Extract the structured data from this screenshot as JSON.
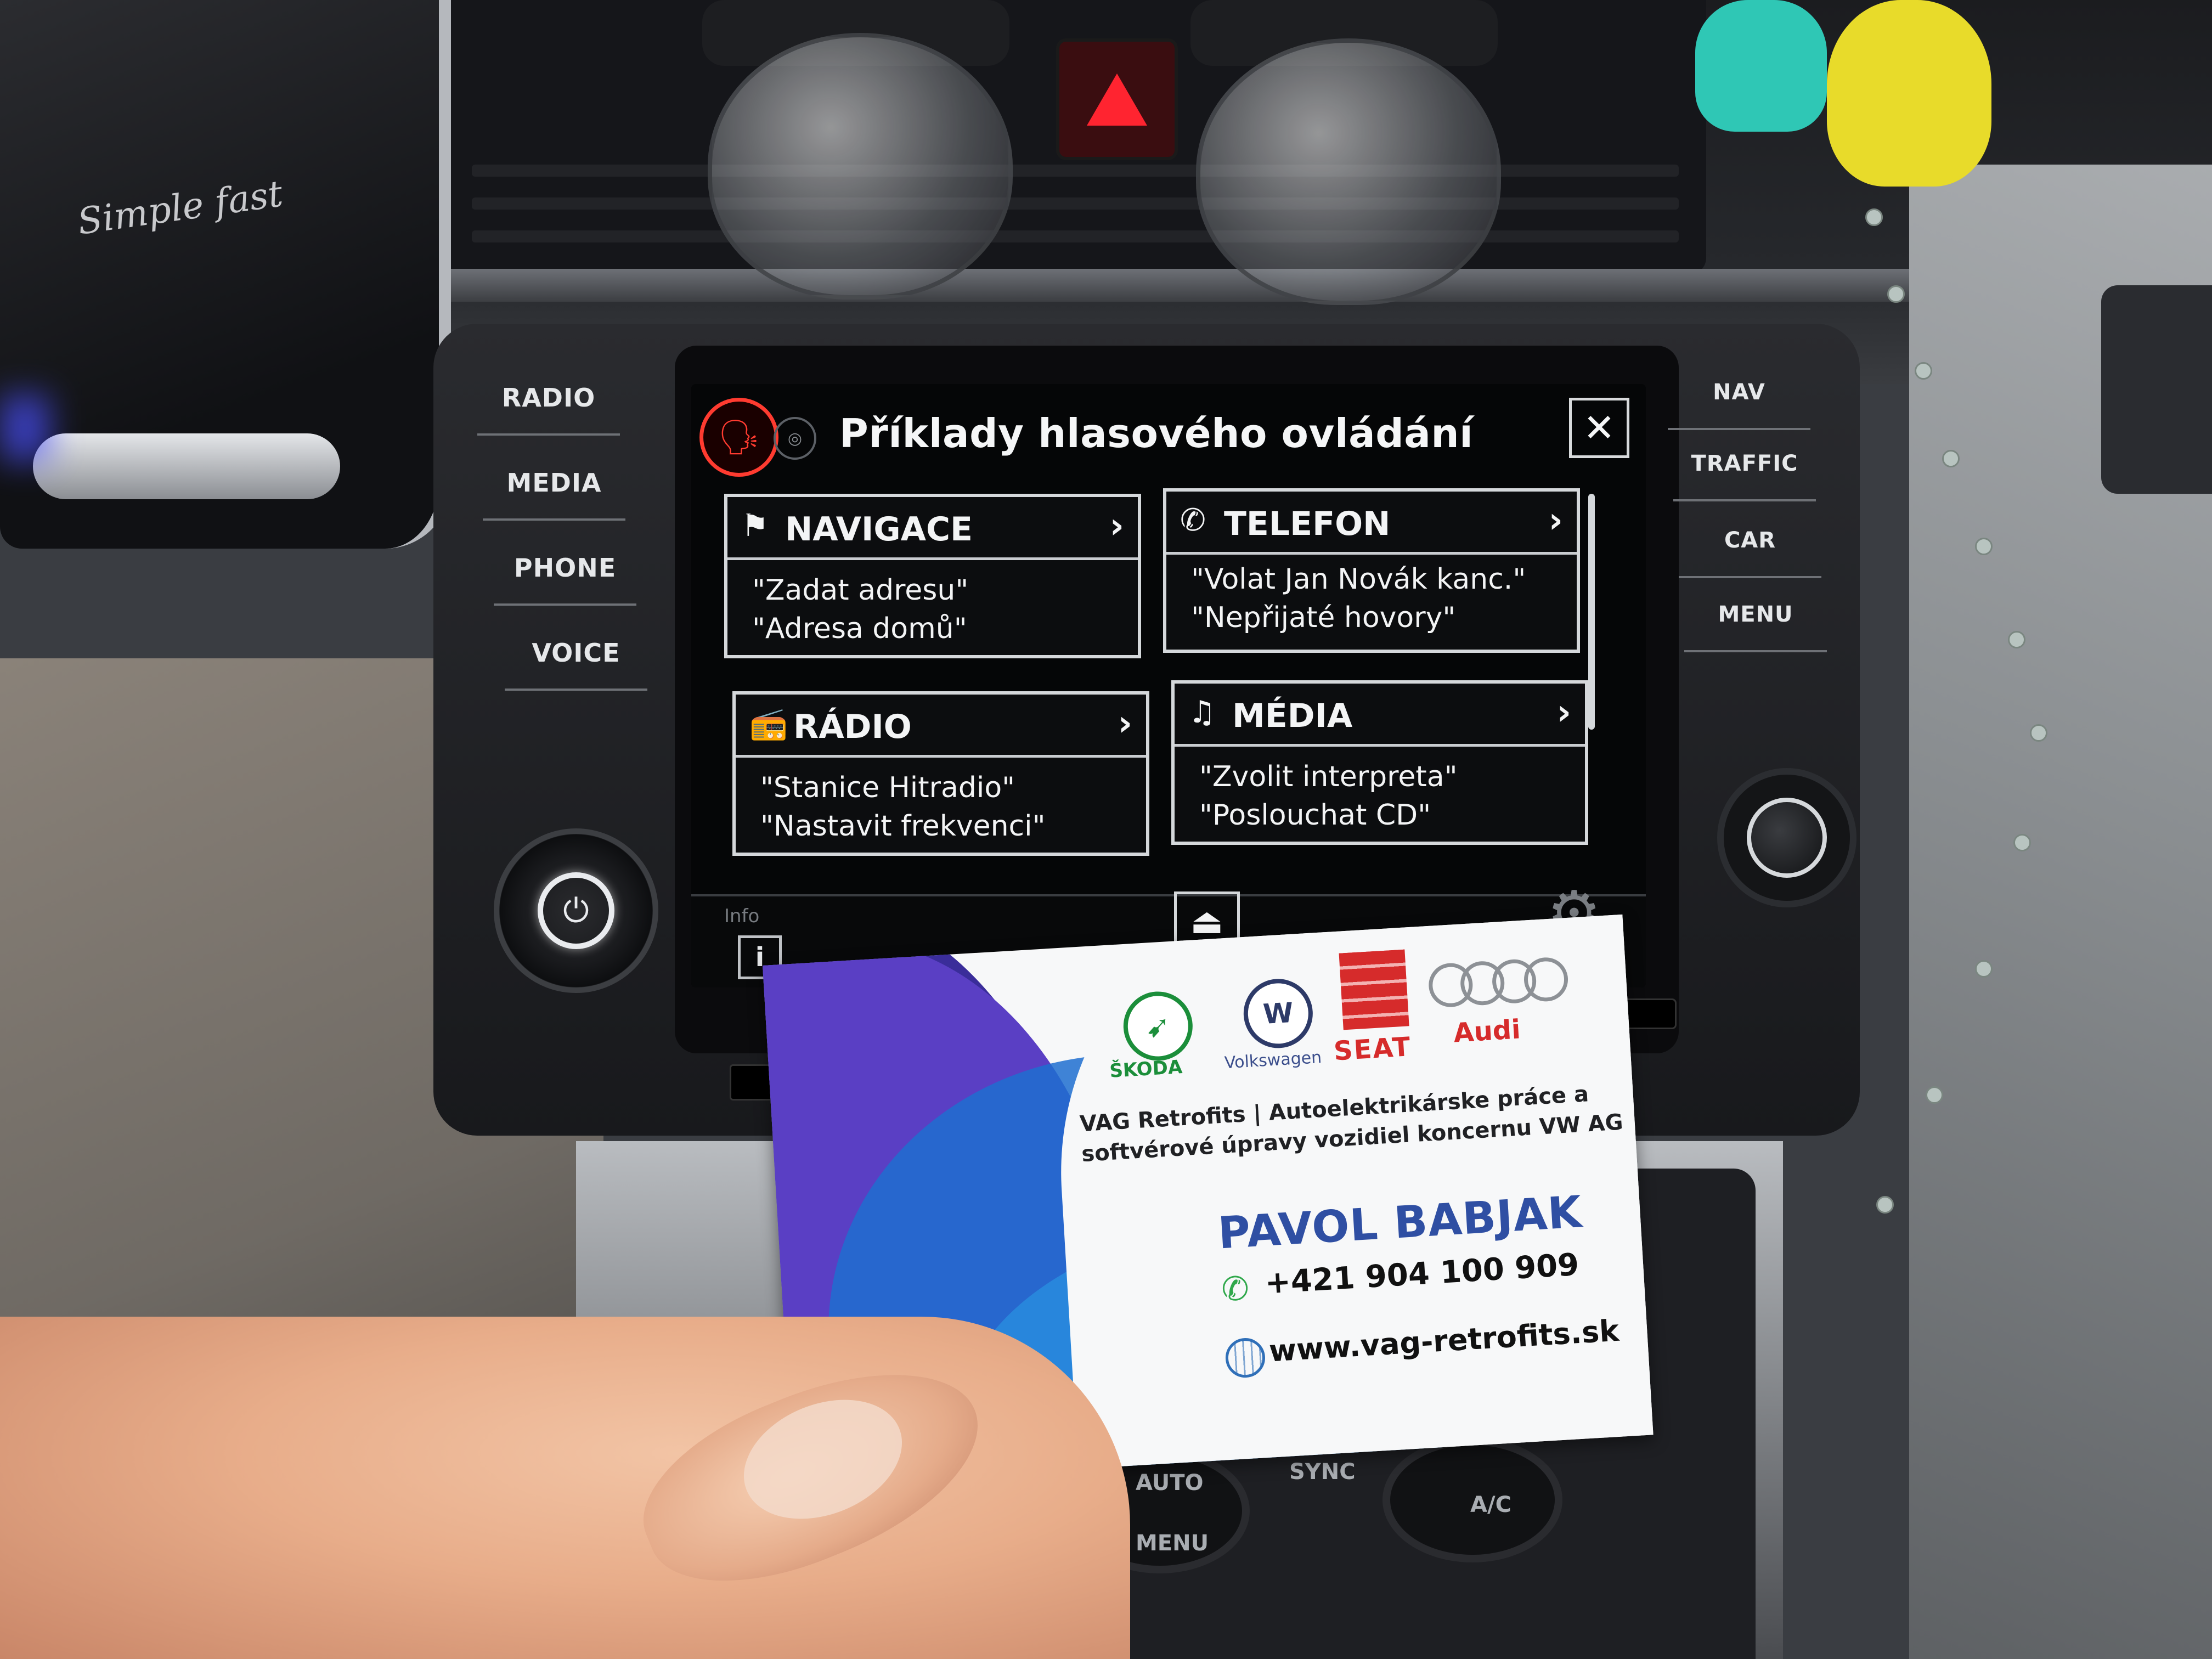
{
  "phone_holder": {
    "brand": "Simple fast"
  },
  "head_unit": {
    "left_buttons": [
      "RADIO",
      "MEDIA",
      "PHONE",
      "VOICE"
    ],
    "right_buttons": [
      "NAV",
      "TRAFFIC",
      "CAR",
      "MENU"
    ]
  },
  "screen": {
    "title": "Příklady hlasového ovládání",
    "close_symbol": "✕",
    "cards": [
      {
        "icon": "flag-icon",
        "title": "NAVIGACE",
        "lines": [
          "\"Zadat adresu\"",
          "\"Adresa domů\""
        ]
      },
      {
        "icon": "phone-icon",
        "title": "TELEFON",
        "lines": [
          "\"Volat Jan Novák kanc.\"",
          "\"Nepřijaté hovory\""
        ]
      },
      {
        "icon": "radio-icon",
        "title": "RÁDIO",
        "lines": [
          "\"Stanice Hitradio\"",
          "\"Nastavit frekvenci\""
        ]
      },
      {
        "icon": "music-note-icon",
        "title": "MÉDIA",
        "lines": [
          "\"Zvolit interpreta\"",
          "\"Poslouchat CD\""
        ]
      }
    ],
    "bottom": {
      "info_label": "Info",
      "info_symbol": "i",
      "eject_symbol": "⏏",
      "settings_symbol": "⚙"
    }
  },
  "business_card": {
    "brands": [
      "ŠKODA",
      "Volkswagen",
      "SEAT",
      "Audi"
    ],
    "tagline_1": "VAG Retrofits | Autoelektrikárske práce a",
    "tagline_2": "softvérové úpravy vozidiel koncernu VW AG",
    "name": "PAVOL BABJAK",
    "phone": "+421 904 100 909",
    "website": "www.vag-retrofits.sk"
  },
  "climate": {
    "auto_label": "AUTO",
    "menu_label": "MENU",
    "sync_label": "SYNC",
    "ac_label": "A/C"
  }
}
